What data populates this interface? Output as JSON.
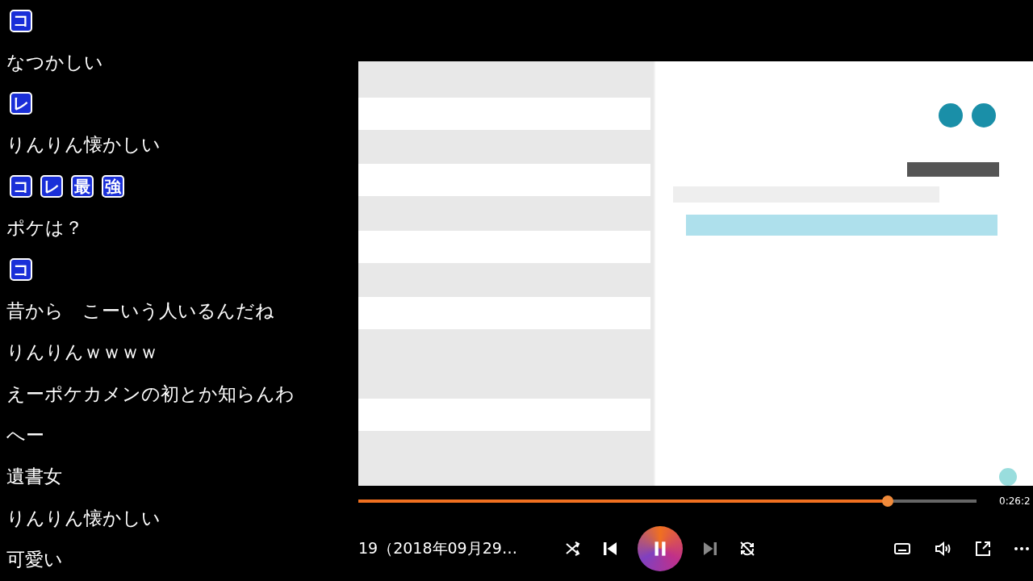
{
  "comments": [
    {
      "kind": "badges",
      "chars": [
        "コ"
      ]
    },
    {
      "kind": "text",
      "text": "なつかしい"
    },
    {
      "kind": "badges",
      "chars": [
        "レ"
      ]
    },
    {
      "kind": "text",
      "text": "りんりん懐かしい"
    },
    {
      "kind": "badges",
      "chars": [
        "コ",
        "レ",
        "最",
        "強"
      ]
    },
    {
      "kind": "text",
      "text": "ポケは？"
    },
    {
      "kind": "badges",
      "chars": [
        "コ"
      ]
    },
    {
      "kind": "text",
      "text": "昔から　こーいう人いるんだね"
    },
    {
      "kind": "text",
      "text": "りんりんｗｗｗｗ"
    },
    {
      "kind": "text",
      "text": "えーポケカメンの初とか知らんわ"
    },
    {
      "kind": "text",
      "text": "へー"
    },
    {
      "kind": "text",
      "text": "遺書女"
    },
    {
      "kind": "text",
      "text": "りんりん懐かしい"
    },
    {
      "kind": "text",
      "text": "可愛い"
    }
  ],
  "player": {
    "progress": {
      "level": 0.856
    },
    "time": "0:26:2",
    "title": "19（2018年09月29…",
    "playing": true,
    "repeat": false
  }
}
